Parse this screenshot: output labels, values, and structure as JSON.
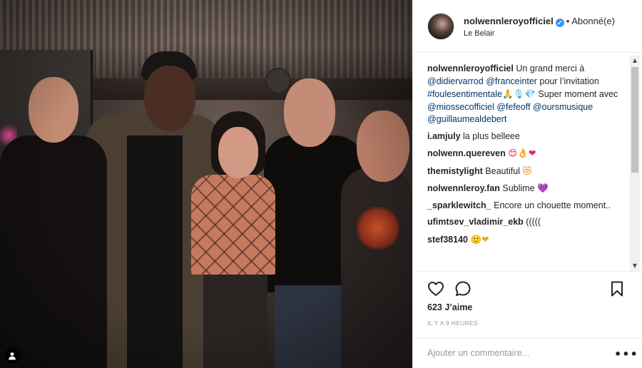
{
  "post": {
    "username": "nolwennleroyofficiel",
    "verified_icon": "verified-badge-icon",
    "follow_label": "Abonné(e)",
    "location": "Le Belair"
  },
  "caption": {
    "username": "nolwennleroyofficiel",
    "text_1": "Un grand merci à",
    "mention_1": "@didiervarrod",
    "mention_2": "@franceinter",
    "text_2": "pour l’invitation",
    "hashtag": "#foulesentimentale",
    "emojis": "🙏🎙💎",
    "text_3": "Super moment avec",
    "mention_3": "@miossecofficiel",
    "mention_4": "@fefeoff",
    "mention_5": "@oursmusique",
    "mention_6": "@guillaumealdebert"
  },
  "comments": [
    {
      "user": "i.amjuly",
      "text": "la plus belleee",
      "emoji": ""
    },
    {
      "user": "nolwenn.quereven",
      "text": "",
      "emoji": "😍👌❤"
    },
    {
      "user": "themistylight",
      "text": "Beautiful",
      "emoji": "😻"
    },
    {
      "user": "nolwennleroy.fan",
      "text": "Sublime",
      "emoji": "💜"
    },
    {
      "user": "_sparklewitch_",
      "text": "Encore un chouette moment..",
      "emoji": ""
    },
    {
      "user": "ufimtsev_vladimir_ekb",
      "text": "(((((",
      "emoji": ""
    },
    {
      "user": "stef38140",
      "text": "",
      "emoji": "🙂❤"
    }
  ],
  "actions": {
    "like_icon": "heart-icon",
    "comment_icon": "comment-bubble-icon",
    "save_icon": "bookmark-icon"
  },
  "likes": {
    "count": "623",
    "label": "J’aime"
  },
  "time_ago": "IL Y A 9 HEURES",
  "comment_input": {
    "placeholder": "Ajouter un commentaire..."
  },
  "more_label": "•••",
  "colors": {
    "link": "#003569",
    "verified": "#3897f0",
    "border": "#efefef",
    "muted": "#999999"
  }
}
